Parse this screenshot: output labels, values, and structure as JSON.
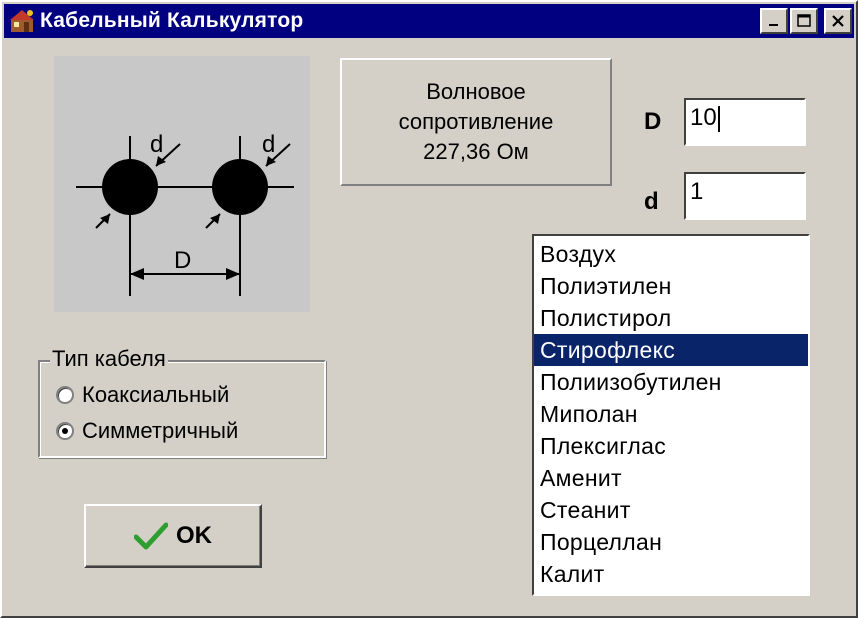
{
  "window": {
    "title": "Кабельный Калькулятор",
    "title_bar_color": "#000080"
  },
  "title_buttons": {
    "minimize_icon": "minimize-icon",
    "maximize_icon": "maximize-icon",
    "close_icon": "close-icon"
  },
  "diagram": {
    "label_d_left": "d",
    "label_d_right": "d",
    "label_D": "D"
  },
  "result": {
    "line1": "Волновое",
    "line2": "сопротивление",
    "line3": "227,36 Ом"
  },
  "inputs": {
    "D_label": "D",
    "D_value": "10",
    "d_label": "d",
    "d_value": "1"
  },
  "materials": {
    "selected": "Стирофлекс",
    "selection_color": "#0a246a",
    "items": [
      "Воздух",
      "Полиэтилен",
      "Полистирол",
      "Стирофлекс",
      "Полиизобутилен",
      "Миполан",
      "Плексиглас",
      "Аменит",
      "Стеанит",
      "Порцеллан",
      "Калит"
    ]
  },
  "cable_type": {
    "legend": "Тип кабеля",
    "option1": "Коаксиальный",
    "option2": "Симметричный",
    "selected": "Симметричный"
  },
  "ok_button": {
    "label": "OK",
    "icon": "checkmark-icon",
    "icon_color": "#2e9e2e"
  }
}
